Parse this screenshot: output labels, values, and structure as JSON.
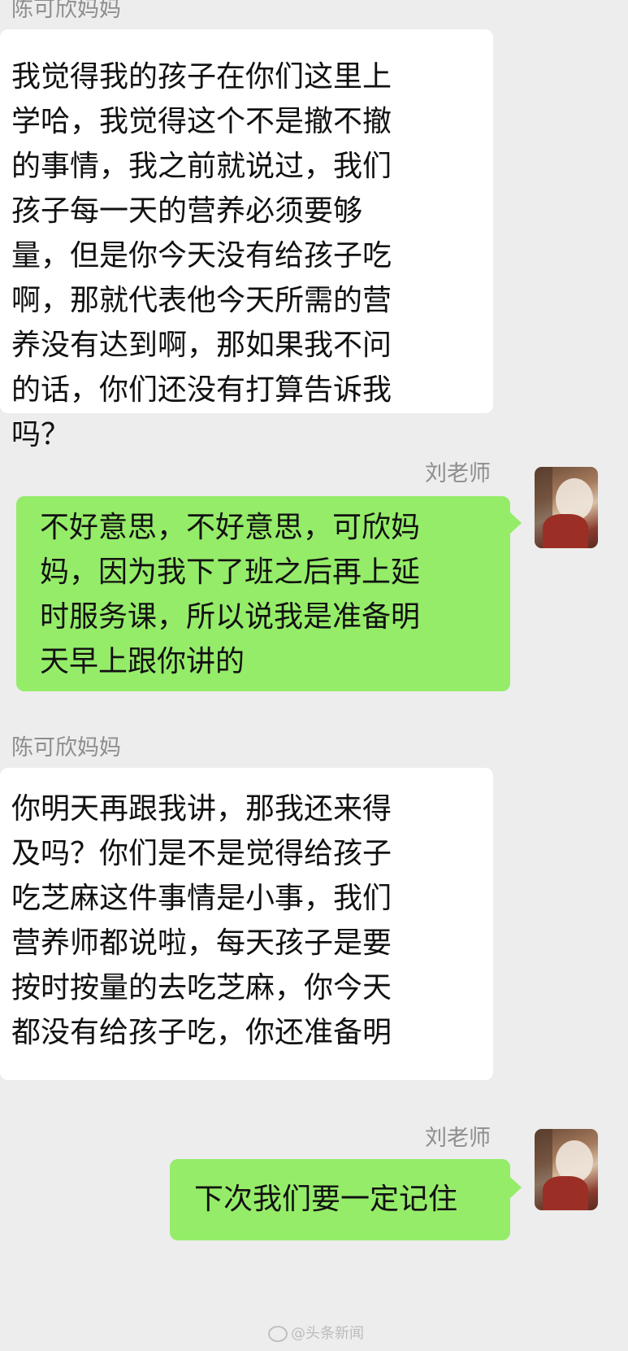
{
  "chat": {
    "messages": [
      {
        "sender": "陈可欣妈妈",
        "side": "left",
        "lines": [
          "我觉得我的孩子在你们这里上",
          "学哈，我觉得这个不是撤不撤",
          "的事情，我之前就说过，我们",
          "孩子每一天的营养必须要够",
          "量，但是你今天没有给孩子吃",
          "啊，那就代表他今天所需的营",
          "养没有达到啊，那如果我不问",
          "的话，你们还没有打算告诉我",
          "吗？"
        ]
      },
      {
        "sender": "刘老师",
        "side": "right",
        "lines": [
          "不好意思，不好意思，可欣妈",
          "妈，因为我下了班之后再上延",
          "时服务课，所以说我是准备明",
          "天早上跟你讲的"
        ]
      },
      {
        "sender": "陈可欣妈妈",
        "side": "left",
        "lines": [
          "你明天再跟我讲，那我还来得",
          "及吗？你们是不是觉得给孩子",
          "吃芝麻这件事情是小事，我们",
          "营养师都说啦，每天孩子是要",
          "按时按量的去吃芝麻，你今天",
          "都没有给孩子吃，你还准备明"
        ]
      },
      {
        "sender": "刘老师",
        "side": "right",
        "lines": [
          "下次我们要一定记住"
        ]
      }
    ]
  },
  "watermark": {
    "icon": "weibo-icon",
    "text": "@头条新闻"
  },
  "colors": {
    "background": "#ededed",
    "incoming_bubble": "#ffffff",
    "outgoing_bubble": "#95ec69",
    "sender_name": "#8e8e8e"
  }
}
